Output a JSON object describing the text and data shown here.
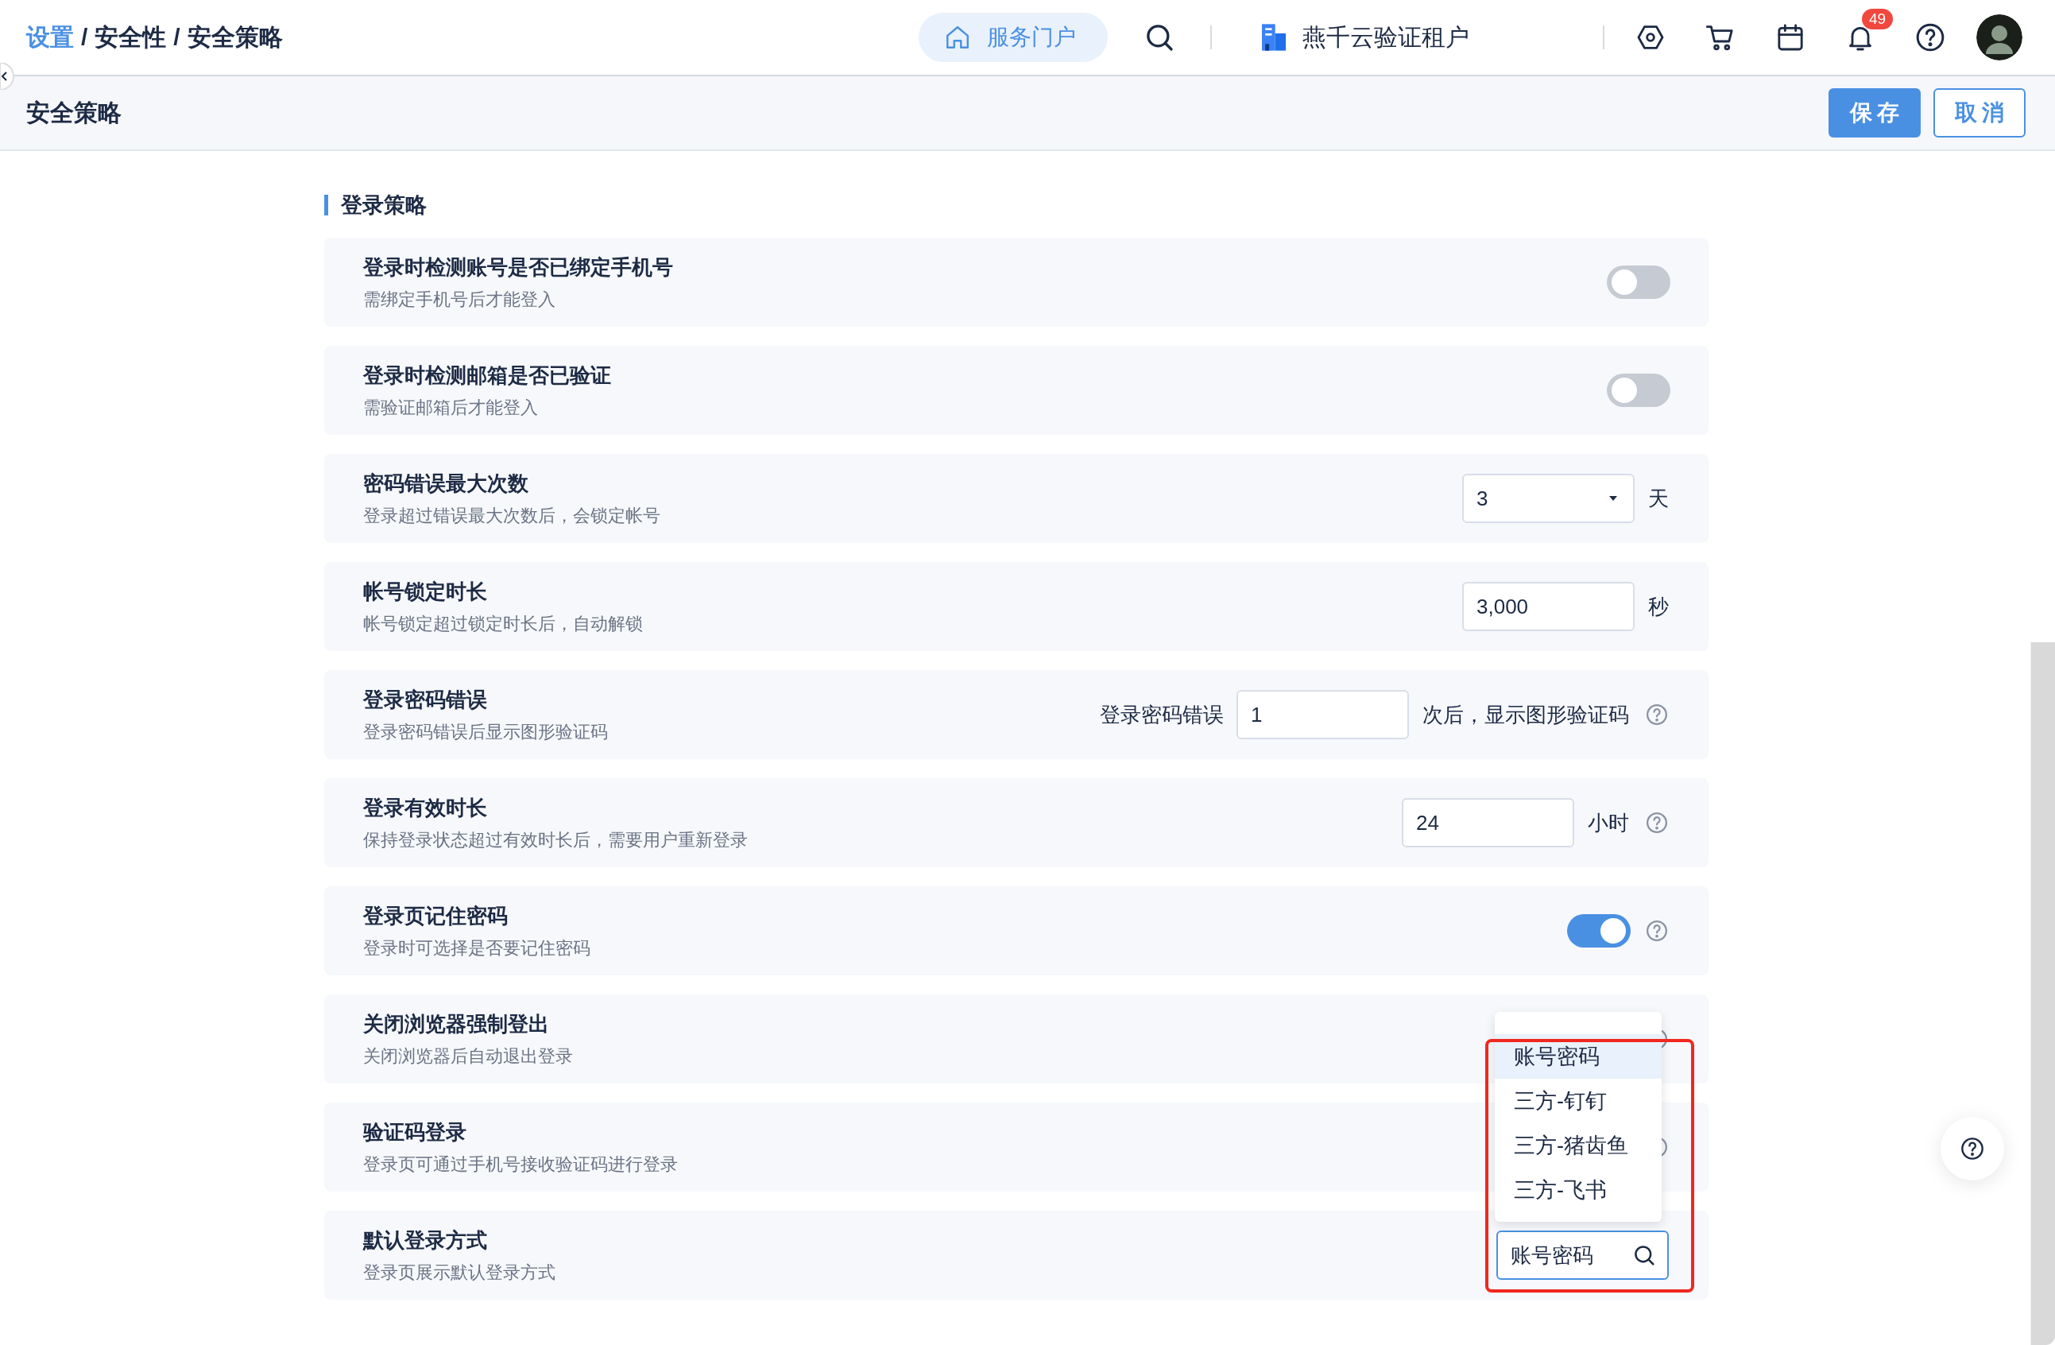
{
  "topbar": {
    "breadcrumb": [
      {
        "label": "设置",
        "link": true
      },
      {
        "label": "安全性",
        "link": false
      },
      {
        "label": "安全策略",
        "link": false
      }
    ],
    "separator": "/",
    "portal_button": "服务门户",
    "tenant": "燕千云验证租户",
    "notification_badge": "49"
  },
  "header": {
    "title": "安全策略",
    "buttons": [
      {
        "label": "保存",
        "primary": true
      },
      {
        "label": "取消",
        "primary": false
      }
    ]
  },
  "section": {
    "title": "登录策略"
  },
  "settings": [
    {
      "title": "登录时检测账号是否已绑定手机号",
      "description": "需绑定手机号后才能登入",
      "kind": "toggle",
      "on": false,
      "help": false
    },
    {
      "title": "登录时检测邮箱是否已验证",
      "description": "需验证邮箱后才能登入",
      "kind": "toggle",
      "on": false,
      "help": false
    },
    {
      "title": "密码错误最大次数",
      "description": "登录超过错误最大次数后，会锁定帐号",
      "kind": "select",
      "value": "3",
      "unit": "天",
      "help": false
    },
    {
      "title": "帐号锁定时长",
      "description": "帐号锁定超过锁定时长后，自动解锁",
      "kind": "number",
      "value": "3,000",
      "unit": "秒",
      "help": false
    },
    {
      "title": "登录密码错误",
      "description": "登录密码错误后显示图形验证码",
      "kind": "number",
      "prefix": "登录密码错误",
      "value": "1",
      "unit": "次后，显示图形验证码",
      "help": true
    },
    {
      "title": "登录有效时长",
      "description": "保持登录状态超过有效时长后，需要用户重新登录",
      "kind": "number",
      "value": "24",
      "unit": "小时",
      "help": true
    },
    {
      "title": "登录页记住密码",
      "description": "登录时可选择是否要记住密码",
      "kind": "toggle",
      "on": true,
      "help": true
    },
    {
      "title": "关闭浏览器强制登出",
      "description": "关闭浏览器后自动退出登录",
      "kind": "hidden",
      "help": true
    },
    {
      "title": "验证码登录",
      "description": "登录页可通过手机号接收验证码进行登录",
      "kind": "hidden",
      "help": true
    },
    {
      "title": "默认登录方式",
      "description": "登录页展示默认登录方式",
      "kind": "search_select",
      "value": "账号密码",
      "help": false,
      "options": [
        {
          "label": "账号密码",
          "selected": true
        },
        {
          "label": "三方-钉钉",
          "selected": false
        },
        {
          "label": "三方-猪齿鱼",
          "selected": false
        },
        {
          "label": "三方-飞书",
          "selected": false
        }
      ]
    }
  ]
}
